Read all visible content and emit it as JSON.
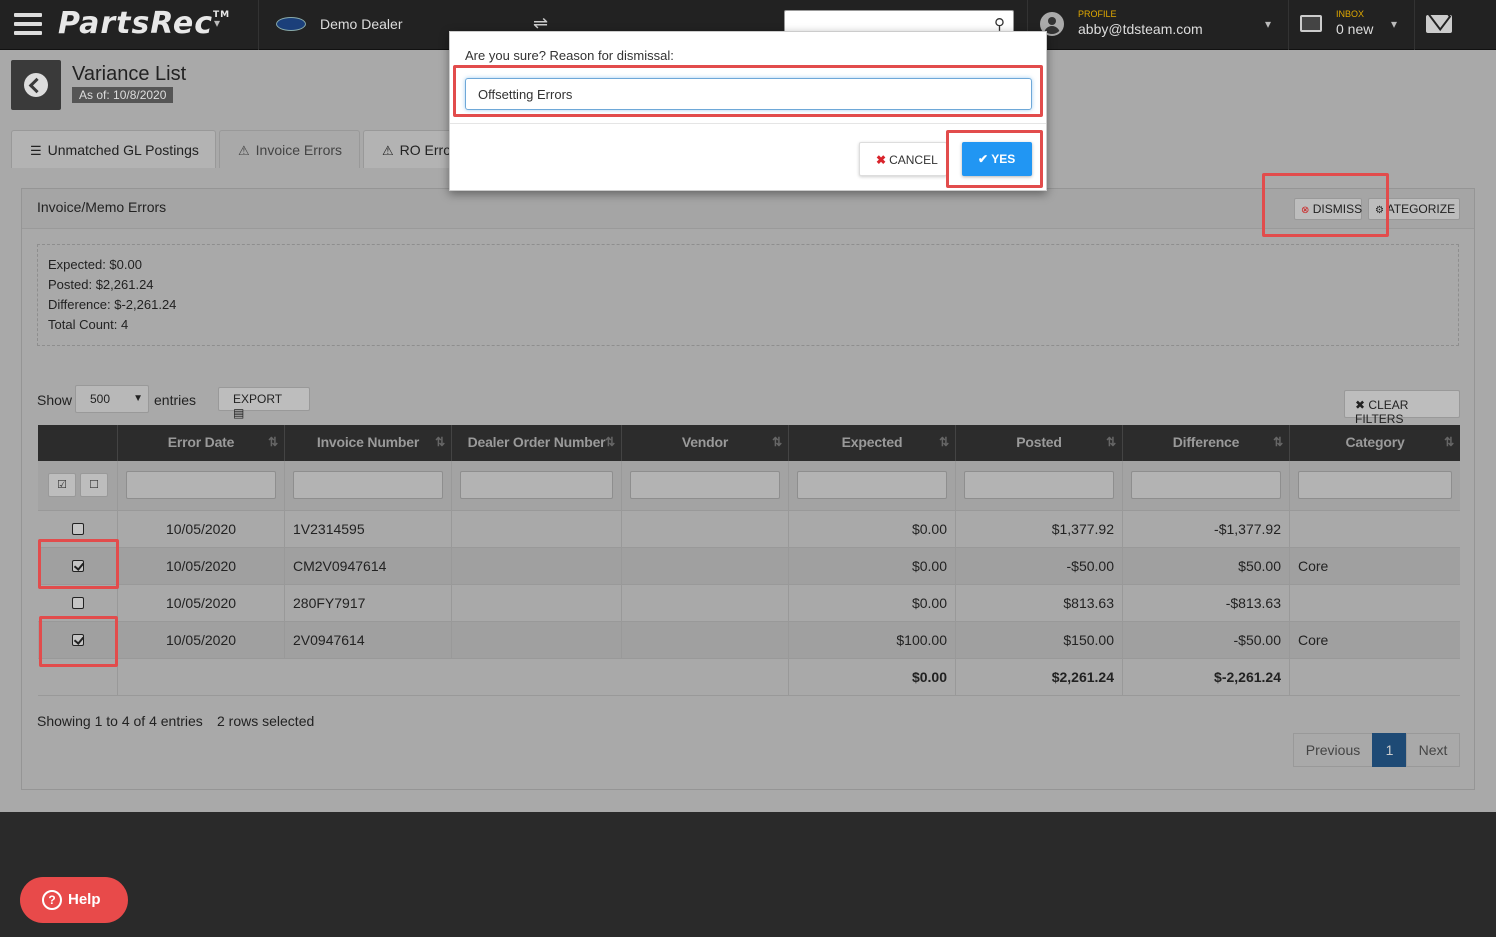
{
  "nav": {
    "logo": "PartsRec",
    "logo_tm": "TM",
    "dealer": "Demo Dealer",
    "profile_label": "PROFILE",
    "profile_email": "abby@tdsteam.com",
    "inbox_label": "INBOX",
    "inbox_count": "0 new"
  },
  "page": {
    "title": "Variance List",
    "as_of": "As of: 10/8/2020"
  },
  "tabs": [
    {
      "label": "Unmatched GL Postings"
    },
    {
      "label": "Invoice Errors"
    },
    {
      "label": "RO Erro"
    }
  ],
  "panel": {
    "title": "Invoice/Memo Errors",
    "dismiss": "DISMISS",
    "categorize": "ATEGORIZE",
    "summary": {
      "expected": "Expected: $0.00",
      "posted": "Posted: $2,261.24",
      "difference": "Difference: $-2,261.24",
      "count": "Total Count: 4"
    }
  },
  "controls": {
    "show": "Show",
    "entries_value": "500",
    "entries": "entries",
    "export": "EXPORT",
    "clear_filters": "CLEAR FILTERS"
  },
  "table": {
    "headers": [
      "Error Date",
      "Invoice Number",
      "Dealer Order Number",
      "Vendor",
      "Expected",
      "Posted",
      "Difference",
      "Category"
    ],
    "rows": [
      {
        "checked": false,
        "date": "10/05/2020",
        "invoice": "1V2314595",
        "order": "",
        "vendor": "",
        "expected": "$0.00",
        "posted": "$1,377.92",
        "difference": "-$1,377.92",
        "category": ""
      },
      {
        "checked": true,
        "date": "10/05/2020",
        "invoice": "CM2V0947614",
        "order": "",
        "vendor": "",
        "expected": "$0.00",
        "posted": "-$50.00",
        "difference": "$50.00",
        "category": "Core"
      },
      {
        "checked": false,
        "date": "10/05/2020",
        "invoice": "280FY7917",
        "order": "",
        "vendor": "",
        "expected": "$0.00",
        "posted": "$813.63",
        "difference": "-$813.63",
        "category": ""
      },
      {
        "checked": true,
        "date": "10/05/2020",
        "invoice": "2V0947614",
        "order": "",
        "vendor": "",
        "expected": "$100.00",
        "posted": "$150.00",
        "difference": "-$50.00",
        "category": "Core"
      }
    ],
    "totals": {
      "expected": "$0.00",
      "posted": "$2,261.24",
      "difference": "$-2,261.24"
    }
  },
  "footer": {
    "showing": "Showing 1 to 4 of 4 entries",
    "selected": "2 rows selected",
    "previous": "Previous",
    "page": "1",
    "next": "Next"
  },
  "help": {
    "label": "Help"
  },
  "modal": {
    "label": "Are you sure? Reason for dismissal:",
    "reason": "Offsetting Errors",
    "cancel": "CANCEL",
    "yes": "YES"
  },
  "colors": {
    "highlight": "#e24c4c",
    "primary": "#2196f3",
    "help": "#e84a4a"
  }
}
